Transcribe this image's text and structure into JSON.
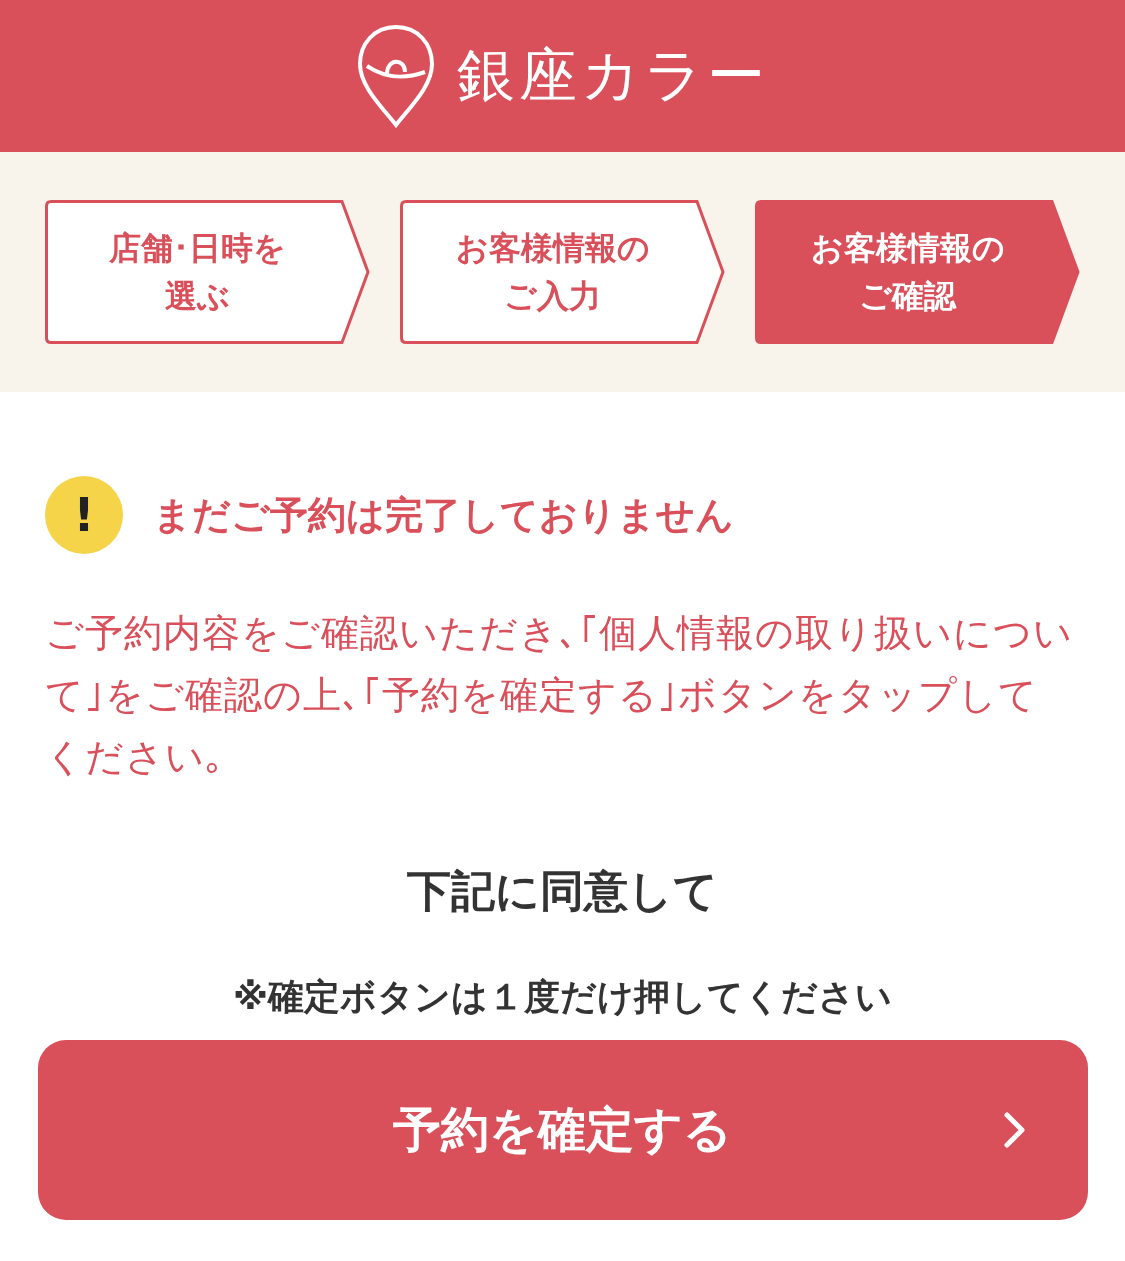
{
  "header": {
    "brand": "銀座カラー"
  },
  "steps": [
    {
      "label": "店舗･日時を選ぶ",
      "selected": false
    },
    {
      "label": "お客様情報のご入力",
      "selected": false
    },
    {
      "label": "お客様情報のご確認",
      "selected": true
    }
  ],
  "notice": {
    "icon": "!",
    "title": "まだご予約は完了しておりません",
    "message": "ご予約内容をご確認いただき､｢個人情報の取り扱いについて｣をご確認の上､｢予約を確定する｣ボタンをタップしてください｡"
  },
  "agree": {
    "heading": "下記に同意して",
    "note": "※確定ボタンは１度だけ押してください",
    "button": "予約を確定する"
  }
}
